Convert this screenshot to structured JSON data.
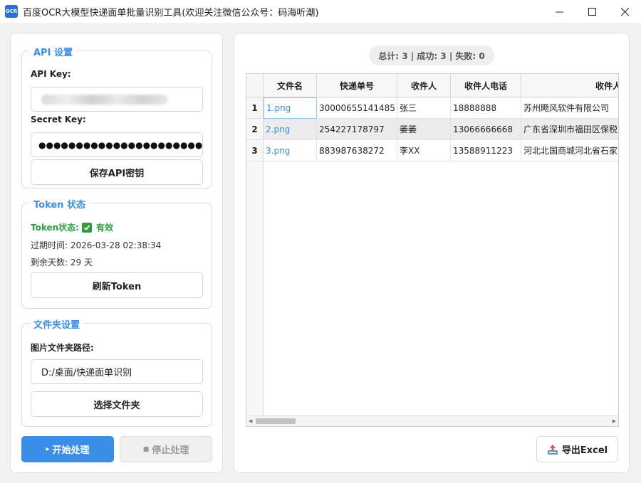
{
  "window": {
    "icon_text": "OCR",
    "title": "百度OCR大模型快递面单批量识别工具(欢迎关注微信公众号：码海听潮)"
  },
  "api_settings": {
    "title": "API 设置",
    "api_key_label": "API Key:",
    "secret_key_label": "Secret Key:",
    "secret_key_value": "●●●●●●●●●●●●●●●●●●●●●●●●●●●●●",
    "save_button": "保存API密钥"
  },
  "token_status": {
    "title": "Token 状态",
    "status_label": "Token状态:",
    "status_value": "有效",
    "expire_text": "过期时间: 2026-03-28 02:38:34",
    "remaining_text": "剩余天数: 29 天",
    "refresh_button": "刷新Token"
  },
  "folder_settings": {
    "title": "文件夹设置",
    "path_label": "图片文件夹路径:",
    "path_value": "D:/桌面/快递面单识别",
    "select_button": "选择文件夹"
  },
  "actions": {
    "start_icon": "▸",
    "start_label": "开始处理",
    "stop_icon": "■",
    "stop_label": "停止处理",
    "export_label": "导出Excel"
  },
  "summary": "总计: 3 | 成功: 3 | 失败: 0",
  "table": {
    "columns": [
      "文件名",
      "快递单号",
      "收件人",
      "收件人电话",
      "收件人"
    ],
    "rows": [
      {
        "index": "1",
        "file": "1.png",
        "tracking": "30000655141485",
        "name": "张三",
        "phone": "18888888",
        "address": "苏州飏风软件有限公司"
      },
      {
        "index": "2",
        "file": "2.png",
        "tracking": "254227178797",
        "name": "萎萎",
        "phone": "13066666668",
        "address": "广东省深圳市福田区保税"
      },
      {
        "index": "3",
        "file": "3.png",
        "tracking": "883987638272",
        "name": "李XX",
        "phone": "13588911223",
        "address": "河北北国商城河北省石家"
      }
    ]
  },
  "colors": {
    "accent": "#3a8ee6",
    "success": "#2e9e3d",
    "disabled_text": "#9a9a9a"
  }
}
